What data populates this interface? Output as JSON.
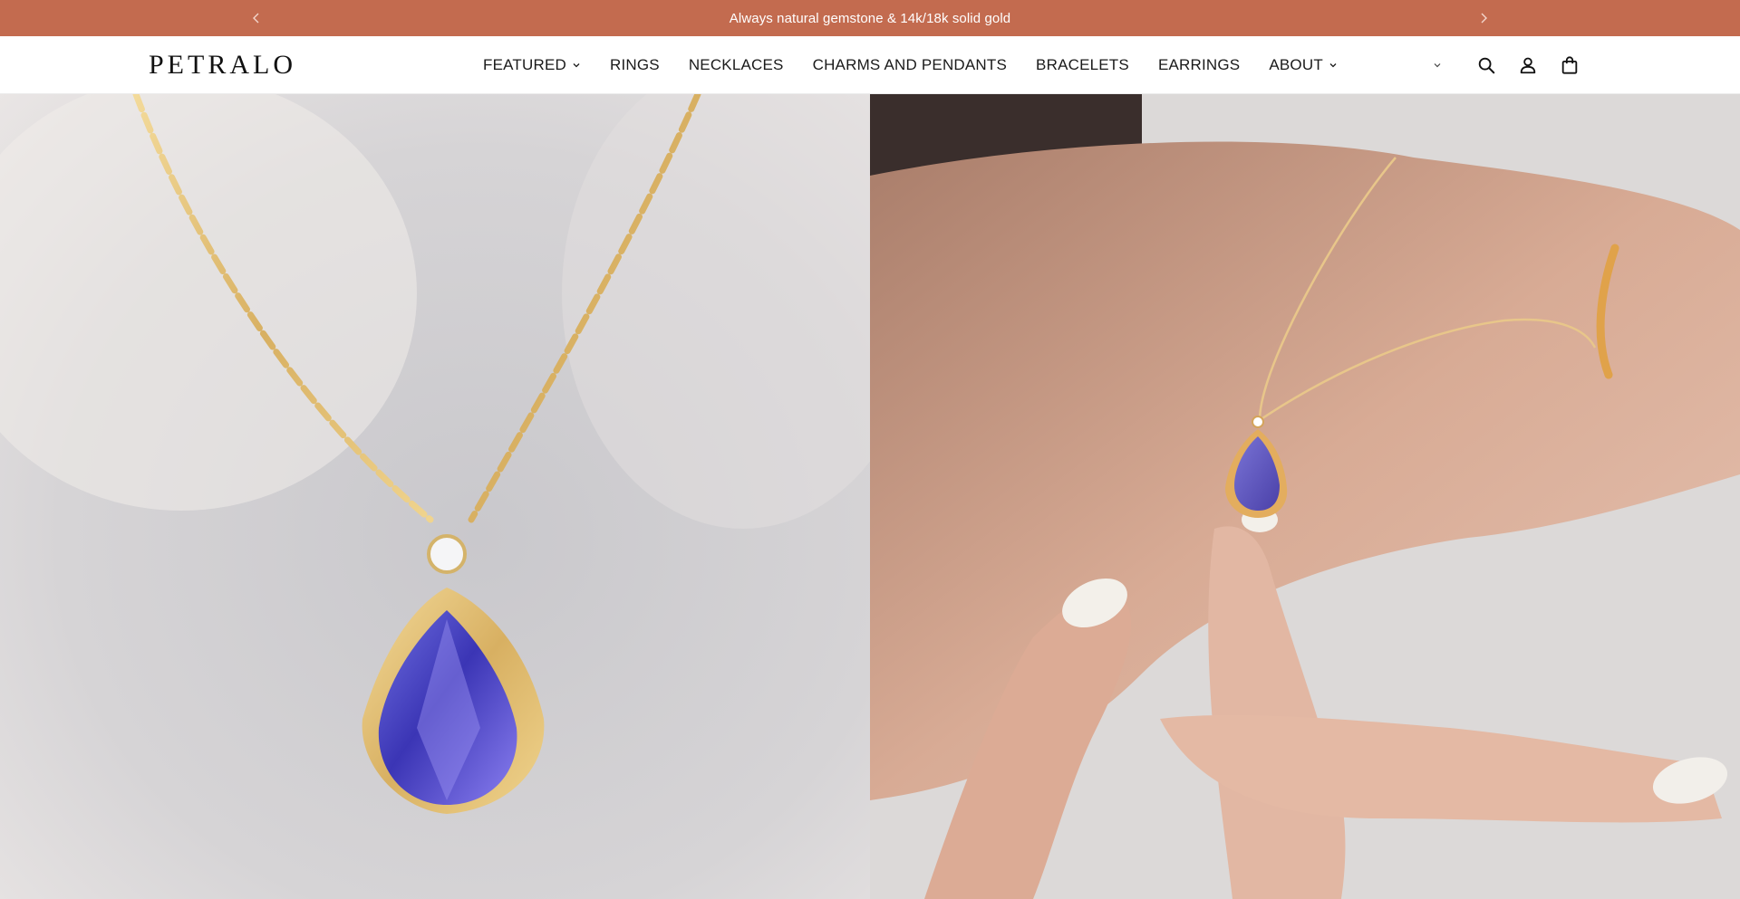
{
  "announcement": {
    "text": "Always natural gemstone & 14k/18k solid gold",
    "prev_icon": "chevron-left-icon",
    "next_icon": "chevron-right-icon"
  },
  "header": {
    "logo": "PETRALO",
    "nav": [
      {
        "label": "FEATURED",
        "has_dropdown": true
      },
      {
        "label": "RINGS",
        "has_dropdown": false
      },
      {
        "label": "NECKLACES",
        "has_dropdown": false
      },
      {
        "label": "CHARMS AND PENDANTS",
        "has_dropdown": false
      },
      {
        "label": "BRACELETS",
        "has_dropdown": false
      },
      {
        "label": "EARRINGS",
        "has_dropdown": false
      },
      {
        "label": "ABOUT",
        "has_dropdown": true
      }
    ],
    "icons": [
      "chevron-down-icon",
      "search-icon",
      "account-icon",
      "cart-icon"
    ]
  },
  "hero": {
    "left_image": "tanzanite-pear-pendant-closeup",
    "right_image": "tanzanite-pendant-on-hand"
  },
  "colors": {
    "announcement_bg": "#c36b4f",
    "announcement_text": "#ffffff",
    "header_bg": "#ffffff",
    "nav_text": "#1a1a1a"
  }
}
